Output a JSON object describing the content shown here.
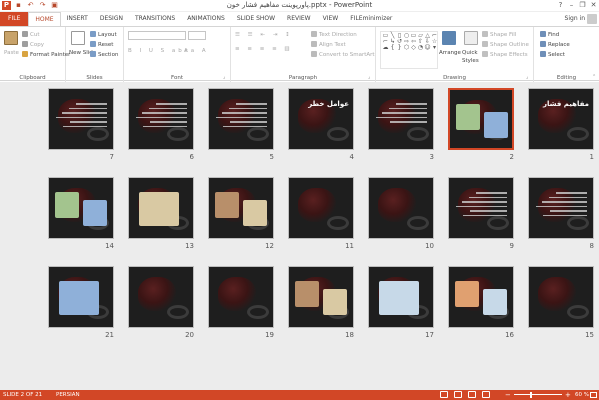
{
  "titlebar": {
    "title": "پاورپوینت مفاهیم فشار خون.pptx - PowerPoint",
    "quick_access": [
      "save-icon",
      "undo-icon",
      "redo-icon",
      "present-icon"
    ],
    "window_controls": [
      "?",
      "–",
      "❐",
      "✕"
    ]
  },
  "tabs": [
    "FILE",
    "HOME",
    "INSERT",
    "DESIGN",
    "TRANSITIONS",
    "ANIMATIONS",
    "SLIDE SHOW",
    "REVIEW",
    "VIEW",
    "FILEminimizer"
  ],
  "active_tab": "HOME",
  "sign_in": "Sign in",
  "ribbon": {
    "clipboard": {
      "label": "Clipboard",
      "paste": "Paste",
      "cut": "Cut",
      "copy": "Copy",
      "format_painter": "Format Painter"
    },
    "slides": {
      "label": "Slides",
      "new_slide": "New Slide",
      "layout": "Layout",
      "reset": "Reset",
      "section": "Section"
    },
    "font": {
      "label": "Font",
      "font_name": "",
      "font_size": ""
    },
    "paragraph": {
      "label": "Paragraph",
      "text_direction": "Text Direction",
      "align_text": "Align Text",
      "smartart": "Convert to SmartArt"
    },
    "drawing": {
      "label": "Drawing",
      "arrange": "Arrange",
      "quick_styles": "Quick Styles",
      "shape_fill": "Shape Fill",
      "shape_outline": "Shape Outline",
      "shape_effects": "Shape Effects"
    },
    "editing": {
      "label": "Editing",
      "find": "Find",
      "replace": "Replace",
      "select": "Select"
    }
  },
  "slides": [
    {
      "num": "1",
      "title": "مفاهیم فشار خون",
      "style": "title"
    },
    {
      "num": "2",
      "title": "",
      "style": "images"
    },
    {
      "num": "3",
      "title": "",
      "style": "list"
    },
    {
      "num": "4",
      "title": "عوامل خطر",
      "style": "title"
    },
    {
      "num": "5",
      "title": "",
      "style": "text"
    },
    {
      "num": "6",
      "title": "",
      "style": "text"
    },
    {
      "num": "7",
      "title": "",
      "style": "text"
    },
    {
      "num": "8",
      "title": "",
      "style": "text"
    },
    {
      "num": "9",
      "title": "",
      "style": "text"
    },
    {
      "num": "10",
      "title": "",
      "style": "blank"
    },
    {
      "num": "11",
      "title": "",
      "style": "blank"
    },
    {
      "num": "12",
      "title": "",
      "style": "images"
    },
    {
      "num": "13",
      "title": "",
      "style": "image"
    },
    {
      "num": "14",
      "title": "",
      "style": "images"
    },
    {
      "num": "15",
      "title": "",
      "style": "blank"
    },
    {
      "num": "16",
      "title": "",
      "style": "images"
    },
    {
      "num": "17",
      "title": "",
      "style": "image"
    },
    {
      "num": "18",
      "title": "",
      "style": "images"
    },
    {
      "num": "19",
      "title": "",
      "style": "mid"
    },
    {
      "num": "20",
      "title": "",
      "style": "blank"
    },
    {
      "num": "21",
      "title": "",
      "style": "image"
    }
  ],
  "status": {
    "slide": "SLIDE 2 OF 21",
    "language": "PERSIAN",
    "zoom": "60 %"
  }
}
